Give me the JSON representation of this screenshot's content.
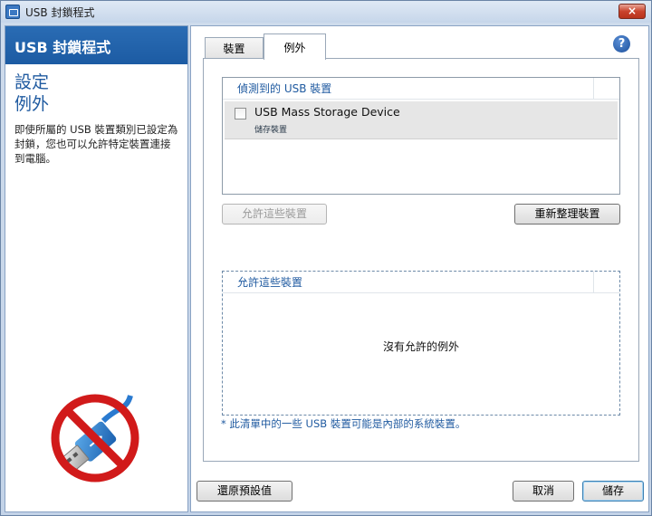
{
  "window": {
    "title": "USB 封鎖程式",
    "close_label": "×"
  },
  "sidebar": {
    "header": "USB 封鎖程式",
    "section_line1": "設定",
    "section_line2": "例外",
    "description": "即使所屬的 USB 裝置類別已設定為封鎖，您也可以允許特定裝置連接到電腦。"
  },
  "tabs": [
    {
      "label": "裝置",
      "active": false
    },
    {
      "label": "例外",
      "active": true
    }
  ],
  "help_label": "?",
  "detected_list": {
    "header": "偵測到的 USB 裝置",
    "items": [
      {
        "name": "USB Mass Storage Device",
        "type": "儲存裝置",
        "checked": false
      }
    ]
  },
  "buttons": {
    "allow": "允許這些裝置",
    "refresh": "重新整理裝置",
    "restore_defaults": "還原預設值",
    "cancel": "取消",
    "save": "儲存"
  },
  "allowed_list": {
    "header": "允許這些裝置",
    "empty_text": "沒有允許的例外"
  },
  "footnote": "* 此清單中的一些 USB 裝置可能是內部的系統裝置。",
  "colors": {
    "accent": "#1f5aa0",
    "header_blue": "#2a6cb4",
    "no_symbol_red": "#d11a1a"
  }
}
